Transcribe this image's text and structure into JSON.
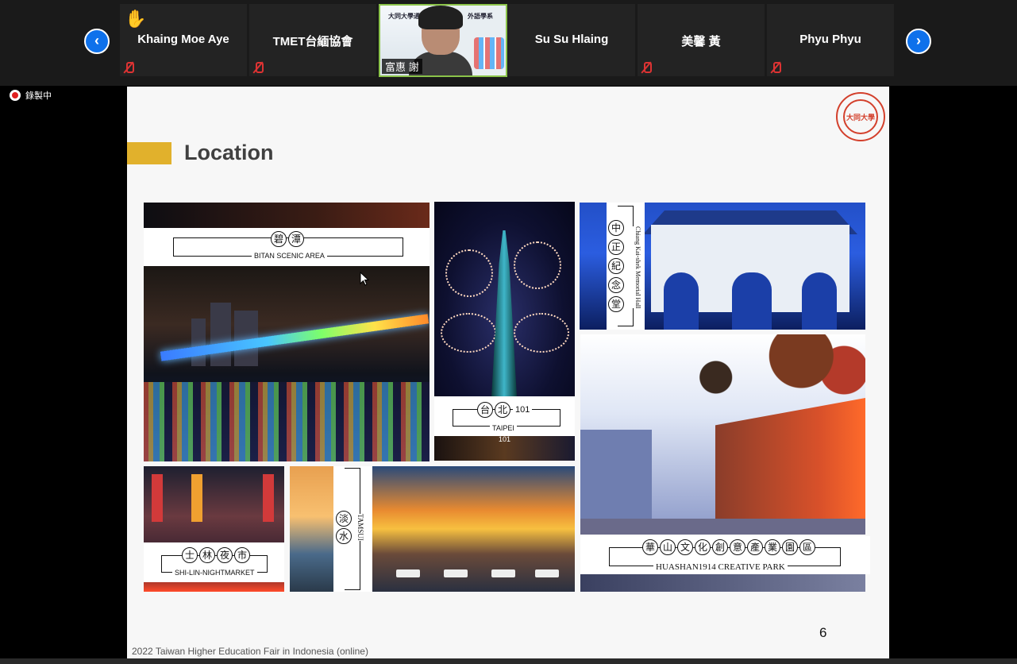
{
  "participants": [
    {
      "name": "Khaing Moe Aye",
      "hand_raised": true
    },
    {
      "name": "TMET台緬協會",
      "hand_raised": false
    },
    {
      "name": "Su Su Hlaing",
      "hand_raised": false
    },
    {
      "name": "美馨 黃",
      "hand_raised": false
    },
    {
      "name": "Phyu Phyu",
      "hand_raised": false
    }
  ],
  "active_speaker": {
    "name": "富惠 謝",
    "banner_left": "大同大學通",
    "banner_right": "外語學系"
  },
  "nav": {
    "prev": "‹",
    "next": "›"
  },
  "recording": {
    "label": "錄製中"
  },
  "slide": {
    "title": "Location",
    "logo_text": "大同大學",
    "page_number": "6",
    "footer": "2022 Taiwan Higher Education Fair in Indonesia (online)",
    "places": {
      "bitan": {
        "cn": [
          "碧",
          "潭"
        ],
        "en": "BITAN SCENIC AREA"
      },
      "taipei101": {
        "cn": [
          "台",
          "北"
        ],
        "num": "101",
        "en": "TAIPEI",
        "sub": "101"
      },
      "ckm": {
        "cn": [
          "中",
          "正",
          "紀",
          "念",
          "堂"
        ],
        "en": "Chiang Kai-shek Memorial Hall"
      },
      "huashan": {
        "cn": [
          "華",
          "山",
          "文",
          "化",
          "創",
          "意",
          "產",
          "業",
          "園",
          "區"
        ],
        "en": "HUASHAN1914 CREATIVE PARK"
      },
      "shilin": {
        "cn": [
          "士",
          "林",
          "夜",
          "市"
        ],
        "en": "SHI-LIN-NIGHTMARKET"
      },
      "tamsui": {
        "cn": [
          "淡",
          "水"
        ],
        "en": "TAMSUI"
      }
    }
  },
  "colors": {
    "accent": "#e1b12c",
    "zoom_blue": "#0e71eb",
    "speaker_border": "#8bc34a",
    "mute_red": "#dd3333"
  }
}
